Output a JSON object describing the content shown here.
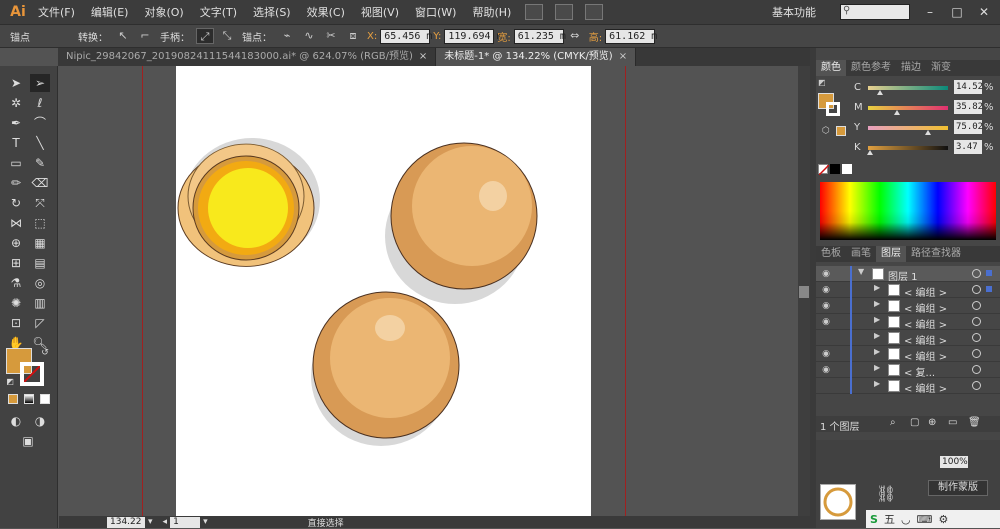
{
  "app": {
    "logo": "Ai"
  },
  "menu": [
    "文件(F)",
    "编辑(E)",
    "对象(O)",
    "文字(T)",
    "选择(S)",
    "效果(C)",
    "视图(V)",
    "窗口(W)",
    "帮助(H)"
  ],
  "workspace": "基本功能",
  "control_bar": {
    "tool_name": "锚点",
    "convert_label": "转换：",
    "handles_label": "手柄：",
    "anchor_label": "锚点：",
    "x_label": "X:",
    "x_value": "65.456 m",
    "y_label": "Y:",
    "y_value": "119.694 m",
    "w_label": "宽:",
    "w_value": "61.235 m",
    "h_label": "高:",
    "h_value": "61.162 m"
  },
  "tabs": [
    {
      "label": "Nipic_29842067_20190824111544183000.ai* @ 624.07% (RGB/预览)",
      "active": false
    },
    {
      "label": "未标题-1* @ 134.22% (CMYK/预览)",
      "active": true
    }
  ],
  "status_bar": {
    "zoom": "134.22",
    "page": "1",
    "tool": "直接选择"
  },
  "color_panel": {
    "tabs": [
      "颜色",
      "颜色参考",
      "描边",
      "渐变"
    ],
    "fill_color": "#d69a3c",
    "channels": [
      {
        "label": "C",
        "value": "14.52",
        "level": 0.15
      },
      {
        "label": "M",
        "value": "35.82",
        "level": 0.36
      },
      {
        "label": "Y",
        "value": "75.02",
        "level": 0.75
      },
      {
        "label": "K",
        "value": "3.47",
        "level": 0.03
      }
    ],
    "pct": "%"
  },
  "layers_panel": {
    "tabs": [
      "色板",
      "画笔",
      "图层",
      "路径查找器"
    ],
    "rows": [
      {
        "name": "图层 1",
        "eye": true,
        "top": true
      },
      {
        "name": "< 编组 >",
        "eye": true
      },
      {
        "name": "< 编组 >",
        "eye": true
      },
      {
        "name": "< 编组 >",
        "eye": true
      },
      {
        "name": "< 编组 >",
        "eye": false
      },
      {
        "name": "< 编组 >",
        "eye": true
      },
      {
        "name": "< 复...",
        "eye": true
      },
      {
        "name": "< 编组 >",
        "eye": false
      }
    ],
    "count": "1 个图层"
  },
  "lower_panel": {
    "zoom_value": "100%",
    "button": "制作蒙版"
  },
  "tray": {
    "ime": "五"
  }
}
